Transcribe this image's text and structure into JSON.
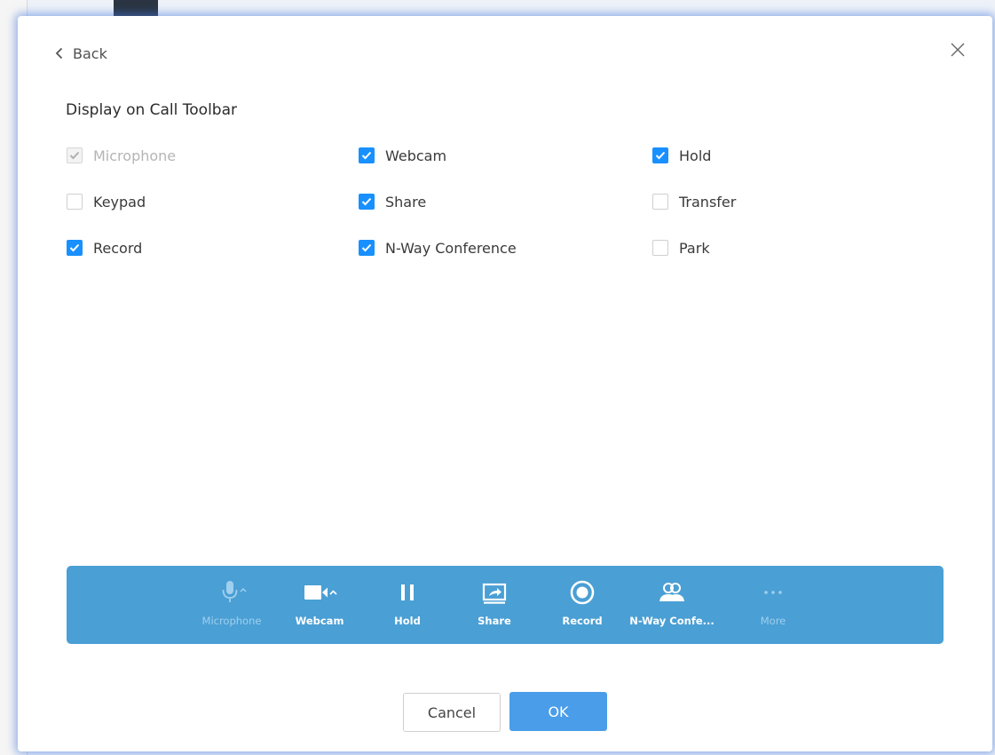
{
  "dialog": {
    "back_label": "Back",
    "heading": "Display on Call Toolbar"
  },
  "options": [
    {
      "label": "Microphone",
      "checked": true,
      "disabled": true
    },
    {
      "label": "Webcam",
      "checked": true,
      "disabled": false
    },
    {
      "label": "Hold",
      "checked": true,
      "disabled": false
    },
    {
      "label": "Keypad",
      "checked": false,
      "disabled": false
    },
    {
      "label": "Share",
      "checked": true,
      "disabled": false
    },
    {
      "label": "Transfer",
      "checked": false,
      "disabled": false
    },
    {
      "label": "Record",
      "checked": true,
      "disabled": false
    },
    {
      "label": "N-Way Conference",
      "checked": true,
      "disabled": false
    },
    {
      "label": "Park",
      "checked": false,
      "disabled": false
    }
  ],
  "toolbar": {
    "color": "#4a9fd4",
    "items": [
      {
        "label": "Microphone",
        "icon": "microphone-icon",
        "dimmed": true
      },
      {
        "label": "Webcam",
        "icon": "webcam-icon",
        "dimmed": false
      },
      {
        "label": "Hold",
        "icon": "pause-icon",
        "dimmed": false
      },
      {
        "label": "Share",
        "icon": "share-screen-icon",
        "dimmed": false
      },
      {
        "label": "Record",
        "icon": "record-icon",
        "dimmed": false
      },
      {
        "label": "N-Way Confe...",
        "icon": "conference-icon",
        "dimmed": false
      },
      {
        "label": "More",
        "icon": "more-dots-icon",
        "dimmed": true
      }
    ]
  },
  "buttons": {
    "cancel_label": "Cancel",
    "ok_label": "OK"
  },
  "colors": {
    "accent": "#1890ff",
    "ok_button": "#4a9de8"
  }
}
